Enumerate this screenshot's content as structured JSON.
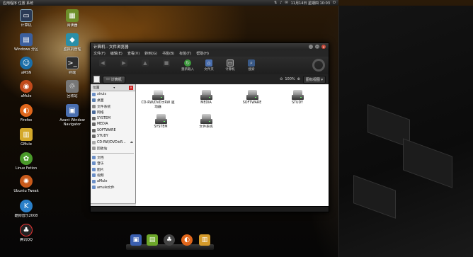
{
  "top_panel": {
    "left_text": "应用程序  位置  系统",
    "clock": "11月14日 星期四 10:03",
    "tray_icons": [
      "network-icon",
      "volume-icon",
      "mail-icon",
      "power-icon"
    ]
  },
  "desktop_icons": [
    {
      "name": "computer",
      "label": "计算机",
      "icon": "monitor-icon",
      "color": "#2a3a55"
    },
    {
      "name": "home",
      "label": "Windows 分区",
      "icon": "drive-icon",
      "color": "#3b5f9e"
    },
    {
      "name": "amsn",
      "label": "aMSN",
      "icon": "amsn-icon",
      "color": "#1a6ea8"
    },
    {
      "name": "amule",
      "label": "aMule",
      "icon": "amule-icon",
      "color": "#c24a1b"
    },
    {
      "name": "firefox",
      "label": "Firefox",
      "icon": "firefox-icon",
      "color": "#e0661b"
    },
    {
      "name": "gmule",
      "label": "GMule",
      "icon": "gmule-icon",
      "color": "#d4a92a"
    },
    {
      "name": "linux-fetion",
      "label": "Linux Fetion",
      "icon": "fetion-icon",
      "color": "#4a9a2a"
    },
    {
      "name": "ubuntu-tweak",
      "label": "Ubuntu Tweak",
      "icon": "ubuntu-icon",
      "color": "#c85a1b"
    },
    {
      "name": "kugou",
      "label": "酷狗音乐2008",
      "icon": "kugou-icon",
      "color": "#2a7fc8"
    },
    {
      "name": "qq",
      "label": "腾讯QQ",
      "icon": "penguin-icon",
      "color": "#222222"
    },
    {
      "name": "books",
      "label": "阅读器",
      "icon": "book-icon",
      "color": "#6d8f2a"
    },
    {
      "name": "cube",
      "label": "虚拟机管理",
      "icon": "cube-icon",
      "color": "#2a8fa8"
    },
    {
      "name": "terminal",
      "label": "终端",
      "icon": "terminal-icon",
      "color": "#2f2f2f"
    },
    {
      "name": "trash",
      "label": "回收站",
      "icon": "trash-icon",
      "color": "#777777"
    },
    {
      "name": "avant",
      "label": "Avant Window Navigator",
      "icon": "avant-icon",
      "color": "#4a6fb0"
    }
  ],
  "window": {
    "title": "计算机 - 文件浏览器",
    "menu": [
      "文件(F)",
      "编辑(E)",
      "查看(V)",
      "转到(G)",
      "书签(B)",
      "标签(T)",
      "帮助(H)"
    ],
    "toolbar": [
      {
        "label": "后退",
        "icon": "back-icon",
        "dim": true
      },
      {
        "label": "前进",
        "icon": "forward-icon",
        "dim": true
      },
      {
        "label": "上级",
        "icon": "up-icon",
        "dim": true
      },
      {
        "label": "停止",
        "icon": "stop-icon",
        "dim": true
      },
      {
        "label": "重新载入",
        "icon": "reload-icon",
        "dim": false
      },
      {
        "label": "文件夹",
        "icon": "home-icon",
        "dim": false
      },
      {
        "label": "计算机",
        "icon": "computer-icon",
        "dim": false
      },
      {
        "label": "搜索",
        "icon": "search-icon",
        "dim": false
      }
    ],
    "location": {
      "crumb": "计算机",
      "zoom": "100%",
      "view_mode": "图标视图"
    },
    "sidebar": {
      "header": "位置",
      "places": [
        {
          "label": "xiruis",
          "icon": "home-folder-icon"
        },
        {
          "label": "桌面",
          "icon": "desktop-icon"
        },
        {
          "label": "文件系统",
          "icon": "filesystem-icon"
        },
        {
          "label": "网络",
          "icon": "network-icon"
        },
        {
          "label": "SYSTEM",
          "icon": "drive-icon"
        },
        {
          "label": "MEDIA",
          "icon": "drive-icon"
        },
        {
          "label": "SOFTWARE",
          "icon": "drive-icon"
        },
        {
          "label": "STUDY",
          "icon": "drive-icon"
        },
        {
          "label": "CD-RW/DVD±R...",
          "icon": "cdrom-icon",
          "eject": true
        },
        {
          "label": "回收站",
          "icon": "trash-icon"
        }
      ],
      "bookmarks": [
        {
          "label": "文档",
          "icon": "folder-icon"
        },
        {
          "label": "音乐",
          "icon": "folder-icon"
        },
        {
          "label": "图片",
          "icon": "folder-icon"
        },
        {
          "label": "视频",
          "icon": "folder-icon"
        },
        {
          "label": "aMule",
          "icon": "folder-icon"
        },
        {
          "label": "amule文件",
          "icon": "folder-icon"
        }
      ]
    },
    "items": [
      {
        "label": "CD-RW/DVD±RW 驱动器",
        "type": "cd"
      },
      {
        "label": "MEDIA",
        "type": "drive"
      },
      {
        "label": "SOFTWARE",
        "type": "drive"
      },
      {
        "label": "STUDY",
        "type": "drive"
      },
      {
        "label": "SYSTEM",
        "type": "drive"
      },
      {
        "label": "文件系统",
        "type": "drive"
      }
    ]
  },
  "dock": {
    "items": [
      {
        "name": "save",
        "icon": "save-icon",
        "color": "#3a5fb0"
      },
      {
        "name": "terminal",
        "icon": "terminal-icon",
        "color": "#6da82a"
      },
      {
        "name": "qq",
        "icon": "penguin-icon",
        "color": "#444444"
      },
      {
        "name": "firefox",
        "icon": "firefox-icon",
        "color": "#e0661b"
      },
      {
        "name": "notes",
        "icon": "notes-icon",
        "color": "#d49a2a"
      }
    ]
  }
}
